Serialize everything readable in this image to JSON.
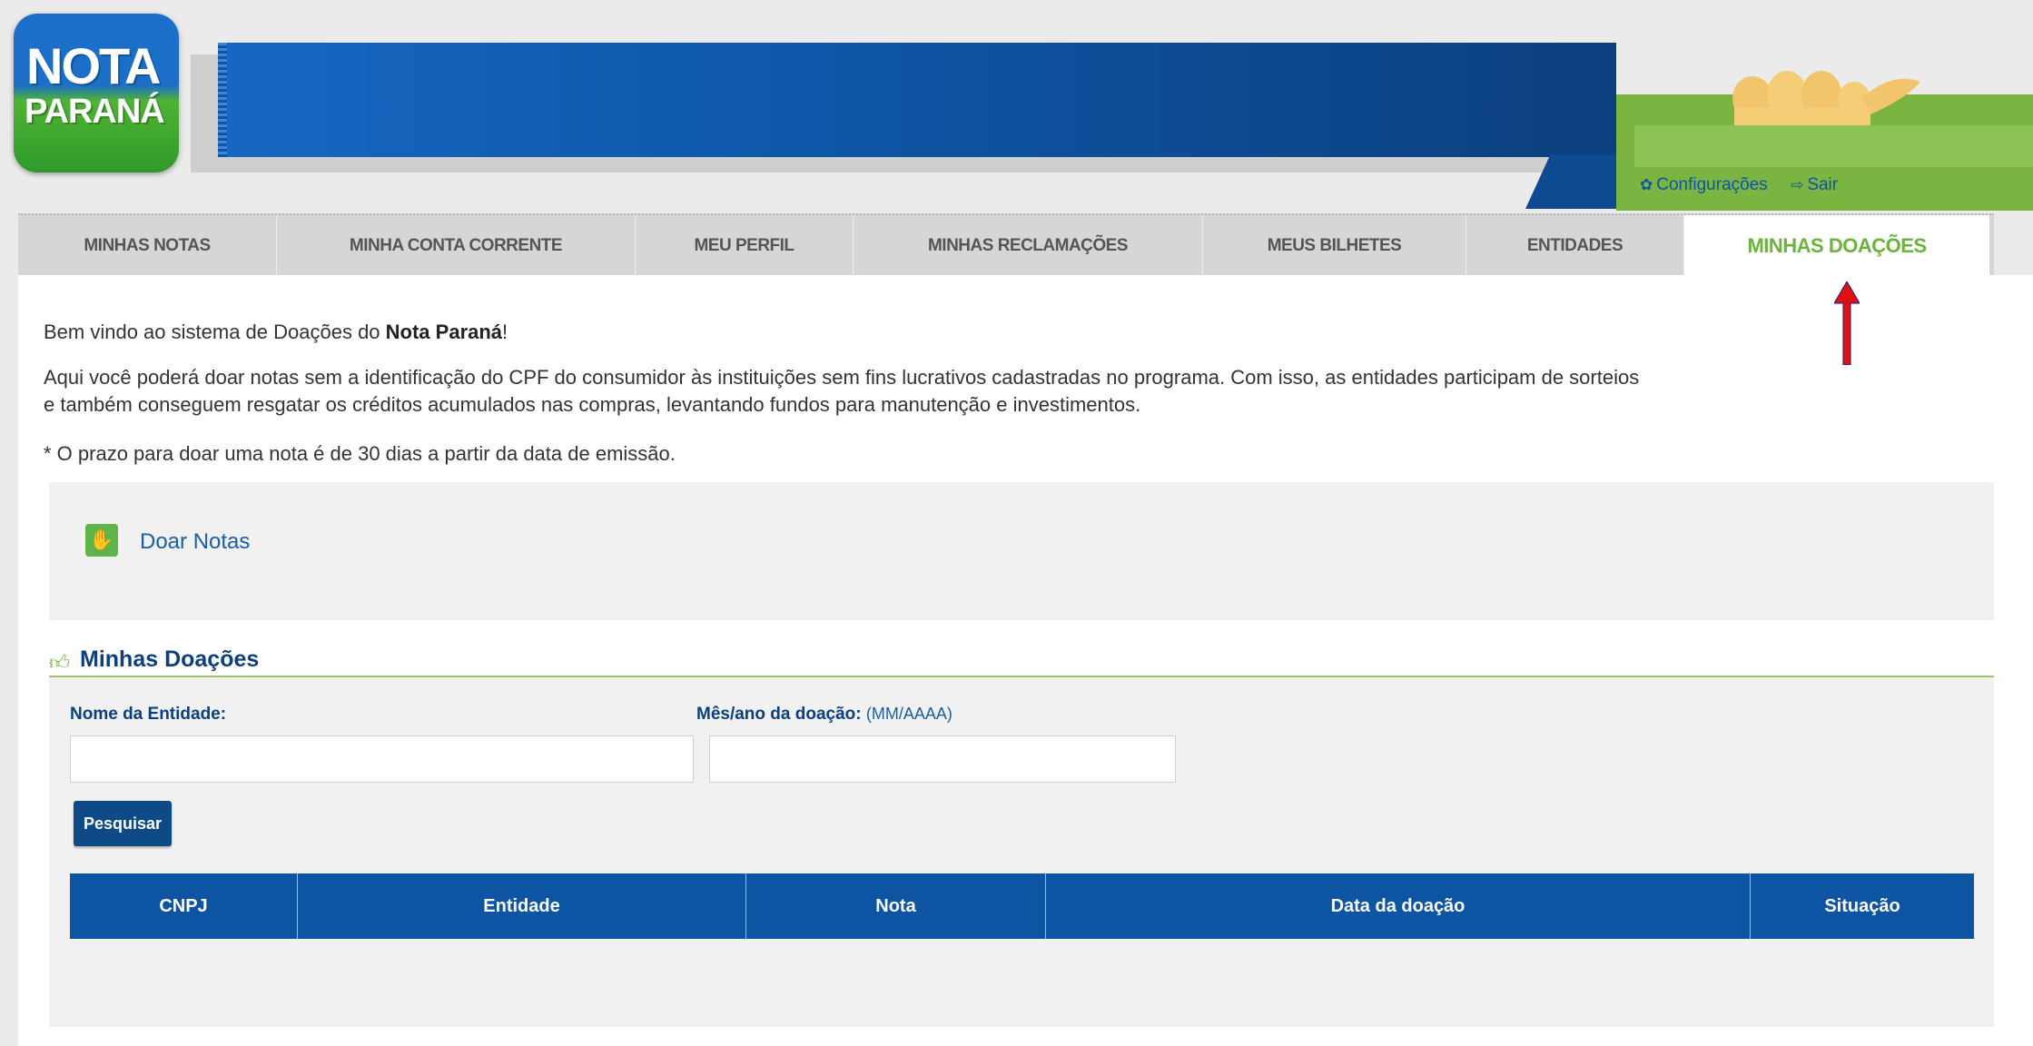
{
  "logo": {
    "line1": "NOTA",
    "line2": "PARANÁ"
  },
  "header_links": {
    "settings": "Configurações",
    "logout": "Sair"
  },
  "tabs": [
    {
      "label": "MINHAS NOTAS"
    },
    {
      "label": "MINHA CONTA CORRENTE"
    },
    {
      "label": "MEU PERFIL"
    },
    {
      "label": "MINHAS RECLAMAÇÕES"
    },
    {
      "label": "MEUS BILHETES"
    },
    {
      "label": "ENTIDADES"
    },
    {
      "label": "MINHAS DOAÇÕES",
      "active": true
    }
  ],
  "intro": {
    "welcome_prefix": "Bem vindo ao sistema de Doações do ",
    "welcome_bold": "Nota Paraná",
    "welcome_suffix": "!",
    "line1": "Aqui você poderá doar notas sem a identificação do CPF do consumidor às instituições sem fins lucrativos cadastradas no programa. Com isso, as entidades participam de sorteios",
    "line2": "e também conseguem resgatar os créditos acumulados nas compras, levantando fundos para manutenção e investimentos.",
    "deadline": "* O prazo para doar uma nota é de 30 dias a partir da data de emissão."
  },
  "actions": {
    "donate_label": "Doar Notas"
  },
  "section": {
    "title": "Minhas Doações"
  },
  "search": {
    "entity_label": "Nome da Entidade:",
    "entity_value": "",
    "month_label": "Mês/ano da doação:",
    "month_hint": "(MM/AAAA)",
    "month_value": "",
    "button": "Pesquisar"
  },
  "table": {
    "columns": [
      "CNPJ",
      "Entidade",
      "Nota",
      "Data da doação",
      "Situação"
    ],
    "rows": []
  },
  "colors": {
    "primary_blue": "#0d55a3",
    "accent_green": "#6ab43a",
    "annotation_arrow": "#e01010"
  }
}
